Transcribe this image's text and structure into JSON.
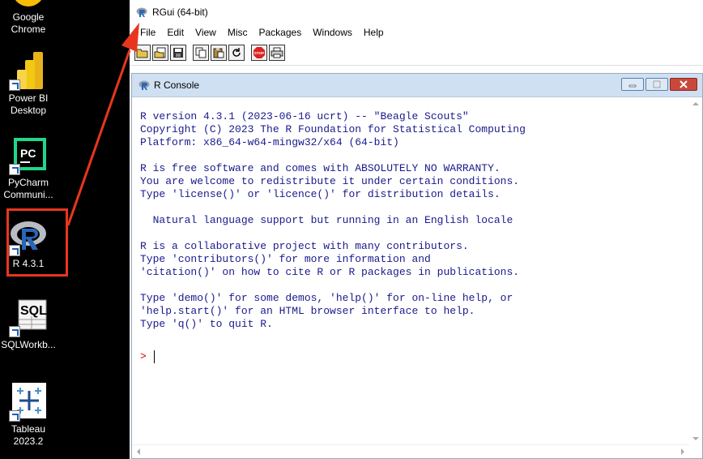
{
  "desktop": {
    "icons": [
      {
        "name": "google-chrome",
        "label": "Google Chrome"
      },
      {
        "name": "power-bi",
        "label": "Power BI Desktop"
      },
      {
        "name": "pycharm",
        "label": "PyCharm Communi..."
      },
      {
        "name": "r",
        "label": "R 4.3.1"
      },
      {
        "name": "sqlworkbench",
        "label": "SQLWorkb..."
      },
      {
        "name": "tableau",
        "label": "Tableau 2023.2"
      }
    ]
  },
  "window": {
    "title": "RGui (64-bit)",
    "menu": [
      "File",
      "Edit",
      "View",
      "Misc",
      "Packages",
      "Windows",
      "Help"
    ],
    "toolbar": [
      "open-script",
      "load-workspace",
      "save-workspace",
      "copy",
      "paste",
      "copy-paste",
      "stop",
      "print"
    ]
  },
  "console": {
    "title": "R Console",
    "lines": [
      "R version 4.3.1 (2023-06-16 ucrt) -- \"Beagle Scouts\"",
      "Copyright (C) 2023 The R Foundation for Statistical Computing",
      "Platform: x86_64-w64-mingw32/x64 (64-bit)",
      "",
      "R is free software and comes with ABSOLUTELY NO WARRANTY.",
      "You are welcome to redistribute it under certain conditions.",
      "Type 'license()' or 'licence()' for distribution details.",
      "",
      "  Natural language support but running in an English locale",
      "",
      "R is a collaborative project with many contributors.",
      "Type 'contributors()' for more information and",
      "'citation()' on how to cite R or R packages in publications.",
      "",
      "Type 'demo()' for some demos, 'help()' for on-line help, or",
      "'help.start()' for an HTML browser interface to help.",
      "Type 'q()' to quit R."
    ],
    "prompt": ">"
  },
  "colors": {
    "annotation": "#e8361e",
    "console_text": "#1a1a8c",
    "prompt": "#d00000"
  }
}
